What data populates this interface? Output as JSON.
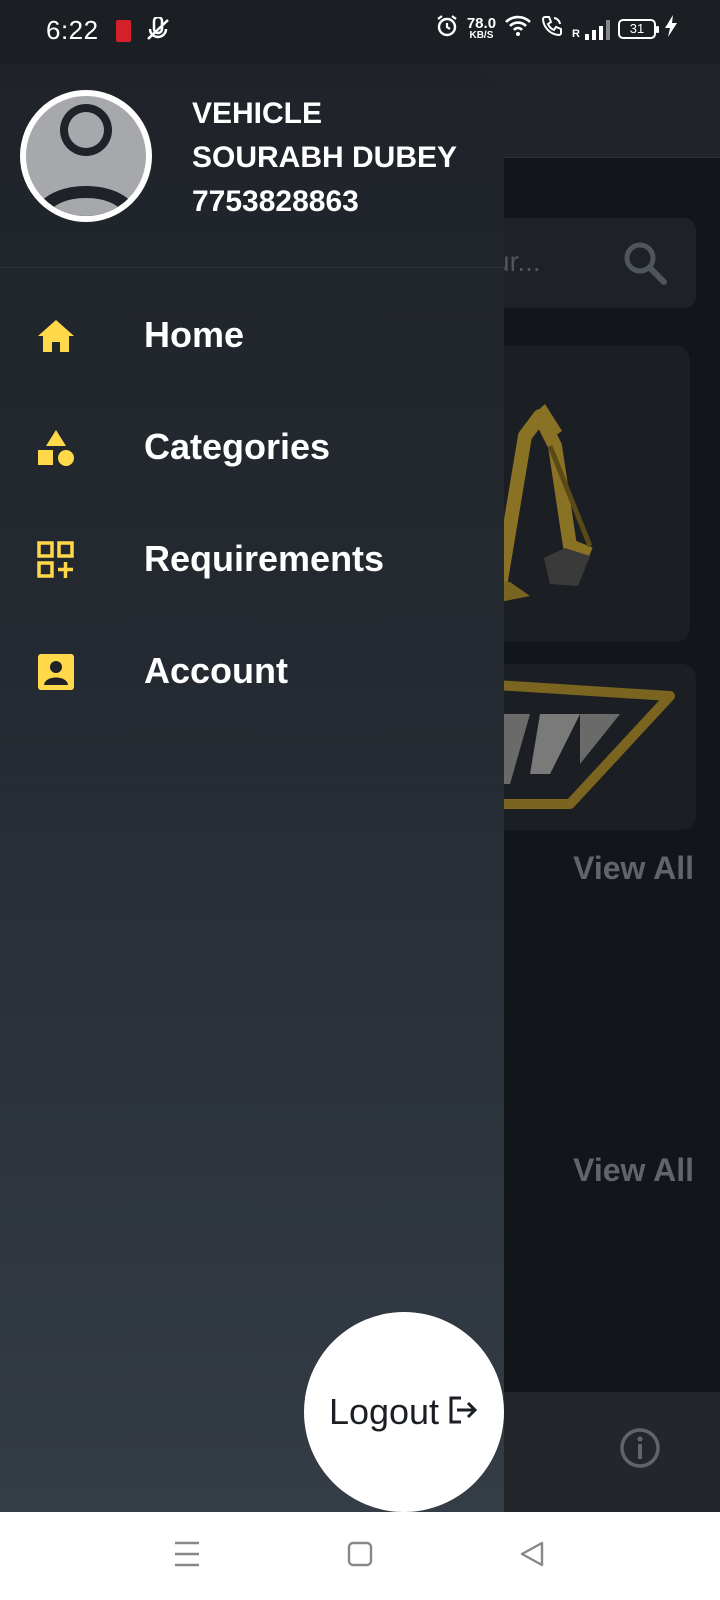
{
  "status_bar": {
    "time": "6:22",
    "net_speed_value": "78.0",
    "net_speed_unit": "KB/S",
    "signal_label": "R",
    "battery": "31",
    "icons": [
      "red-app-icon",
      "mute-mic-icon",
      "alarm-icon",
      "wifi-icon",
      "wifi-call-icon",
      "signal-icon",
      "battery-icon",
      "charging-icon"
    ]
  },
  "drawer": {
    "profile": {
      "line1": "VEHICLE",
      "name": "SOURABH DUBEY",
      "phone": "7753828863"
    },
    "menu": [
      {
        "label": "Home",
        "icon": "home-icon"
      },
      {
        "label": "Categories",
        "icon": "categories-icon"
      },
      {
        "label": "Requirements",
        "icon": "requirements-icon"
      },
      {
        "label": "Account",
        "icon": "account-icon"
      }
    ],
    "logout_label": "Logout"
  },
  "background": {
    "search_placeholder": "ur...",
    "view_all_1": "View All",
    "view_all_2": "View All"
  },
  "colors": {
    "accent": "#FFD94A",
    "drawer_top": "#1f2329",
    "drawer_bottom": "#343c46"
  }
}
